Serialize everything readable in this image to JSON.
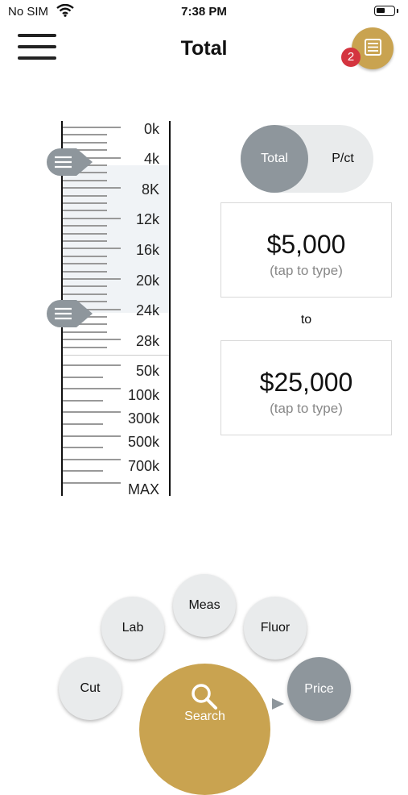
{
  "status_bar": {
    "carrier": "No SIM",
    "time": "7:38 PM"
  },
  "header": {
    "title": "Total",
    "badge_count": "2"
  },
  "ruler": {
    "labels": [
      "0k",
      "4k",
      "8K",
      "12k",
      "16k",
      "20k",
      "24k",
      "28k",
      "50k",
      "100k",
      "300k",
      "500k",
      "700k",
      "MAX"
    ],
    "selected_range": [
      "4k",
      "24k"
    ]
  },
  "toggle": {
    "options": [
      "Total",
      "P/ct"
    ],
    "selected": "Total"
  },
  "price": {
    "min": {
      "value": "$5,000",
      "hint": "(tap to type)"
    },
    "separator": "to",
    "max": {
      "value": "$25,000",
      "hint": "(tap to type)"
    }
  },
  "filters": {
    "cut": "Cut",
    "lab": "Lab",
    "meas": "Meas",
    "fluor": "Fluor",
    "price": "Price",
    "search": "Search"
  },
  "colors": {
    "gold": "#c9a350",
    "gray_active": "#8e969c",
    "bubble": "#e9ebec",
    "badge": "#d4343f"
  }
}
